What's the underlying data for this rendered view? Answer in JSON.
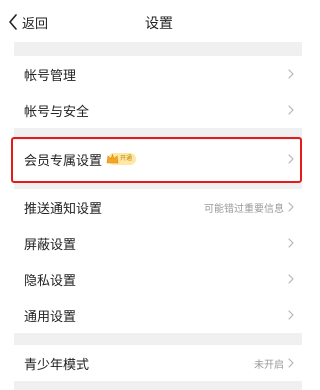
{
  "header": {
    "back_label": "返回",
    "title": "设置"
  },
  "groups": {
    "account": {
      "items": [
        {
          "label": "帐号管理"
        },
        {
          "label": "帐号与安全"
        }
      ]
    },
    "member": {
      "label": "会员专属设置",
      "badge_text": "开通"
    },
    "general": {
      "items": [
        {
          "label": "推送通知设置",
          "right_text": "可能错过重要信息"
        },
        {
          "label": "屏蔽设置"
        },
        {
          "label": "隐私设置"
        },
        {
          "label": "通用设置"
        }
      ]
    },
    "teen": {
      "label": "青少年模式",
      "right_text": "未开启"
    }
  },
  "colors": {
    "section_gap": "#f0f0f0",
    "highlight_border": "#e31b1b",
    "secondary_text": "#999999",
    "badge_bg": "#ffe8a3"
  },
  "icons": {
    "back": "chevron-left-icon",
    "row_arrow": "chevron-right-icon",
    "member_badge": "crown-icon"
  }
}
